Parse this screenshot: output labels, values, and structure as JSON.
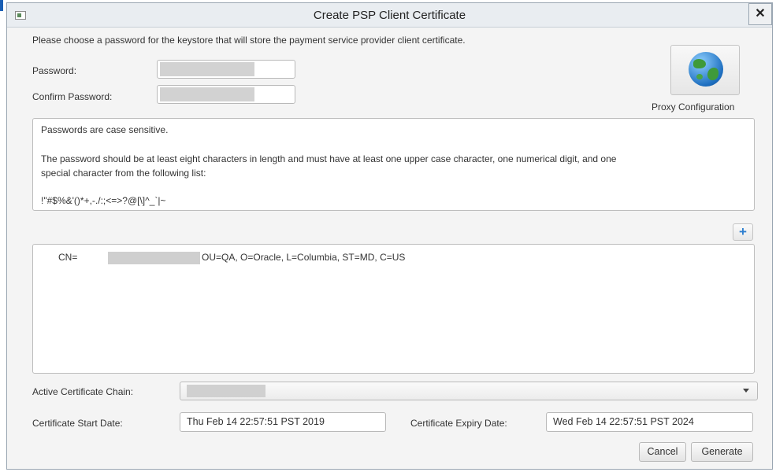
{
  "window": {
    "title": "Create PSP Client Certificate",
    "close_label": "✕"
  },
  "intro": "Please choose a password for the keystore that will store the payment service provider client certificate.",
  "password": {
    "label": "Password:",
    "value": ""
  },
  "confirm_password": {
    "label": "Confirm Password:",
    "value": ""
  },
  "proxy": {
    "label": "Proxy Configuration",
    "icon": "globe-icon"
  },
  "info": {
    "line1": "Passwords are case sensitive.",
    "line2": "The password should be at least eight characters in length and must have at least one upper case character, one numerical digit, and one",
    "line3": "special character from the following list:",
    "line4": "!\"#$%&'()*+,-./:;<=>?@[\\]^_`|~"
  },
  "add_button": {
    "label": "+",
    "icon": "plus-icon"
  },
  "certificate_list": {
    "items": [
      {
        "prefix": "CN=",
        "suffix": "OU=QA, O=Oracle, L=Columbia, ST=MD, C=US"
      }
    ]
  },
  "active_chain": {
    "label": "Active Certificate Chain:",
    "value": ""
  },
  "start_date": {
    "label": "Certificate Start Date:",
    "value": "Thu Feb 14 22:57:51 PST 2019"
  },
  "expiry_date": {
    "label": "Certificate Expiry Date:",
    "value": "Wed Feb 14 22:57:51 PST 2024"
  },
  "buttons": {
    "cancel": "Cancel",
    "generate": "Generate"
  }
}
